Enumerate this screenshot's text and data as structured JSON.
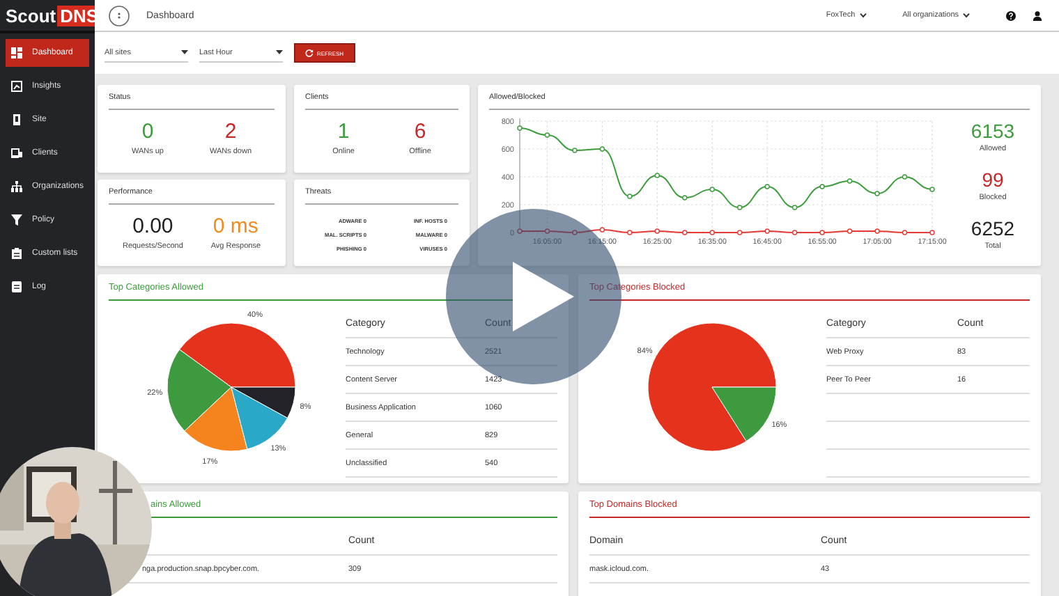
{
  "sidebar": {
    "logo": {
      "text": "Scout",
      "badge": "DNS"
    },
    "items": [
      {
        "label": "Dashboard",
        "selected": true
      },
      {
        "label": "Insights",
        "selected": false
      },
      {
        "label": "Site",
        "selected": false
      },
      {
        "label": "Clients",
        "selected": false
      },
      {
        "label": "Organizations",
        "selected": false
      },
      {
        "label": "Policy",
        "selected": false
      },
      {
        "label": "Custom lists",
        "selected": false
      },
      {
        "label": "Log",
        "selected": false
      }
    ]
  },
  "topbar": {
    "title": "Dashboard",
    "org": "FoxTech",
    "scope": "All organizations"
  },
  "filters": {
    "site": "All sites",
    "range": "Last Hour",
    "refresh": "REFRESH"
  },
  "status": {
    "title": "Status",
    "stats": [
      {
        "value": "0",
        "label": "WANs up",
        "color": "#3a9d3a"
      },
      {
        "value": "2",
        "label": "WANs down",
        "color": "#c62828"
      }
    ]
  },
  "performance": {
    "title": "Performance",
    "stats": [
      {
        "value": "0.00",
        "label": "Requests/Second",
        "color": "#222222"
      },
      {
        "value": "0 ms",
        "label": "Avg Response",
        "color": "#f08c1e"
      }
    ]
  },
  "clients": {
    "title": "Clients",
    "stats": [
      {
        "value": "1",
        "label": "Online",
        "color": "#3a9d3a"
      },
      {
        "value": "6",
        "label": "Offline",
        "color": "#c62828"
      }
    ]
  },
  "threats": {
    "title": "Threats",
    "items": [
      {
        "label": "ADWARE",
        "count": "0"
      },
      {
        "label": "INF. HOSTS",
        "count": "0"
      },
      {
        "label": "MAL. SCRIPTS",
        "count": "0"
      },
      {
        "label": "MALWARE",
        "count": "0"
      },
      {
        "label": "PHISHING",
        "count": "0"
      },
      {
        "label": "VIRUSES",
        "count": "0"
      }
    ]
  },
  "traffic": {
    "title": "Allowed/Blocked",
    "chart_data": {
      "type": "line",
      "grid": true,
      "categories": [
        null,
        "16:05:00",
        null,
        "16:15:00",
        null,
        "16:25:00",
        null,
        "16:35:00",
        null,
        "16:45:00",
        null,
        "16:55:00",
        null,
        "17:05:00",
        null,
        "17:15:00"
      ],
      "series": [
        {
          "color": "#3a9d3a",
          "marker": "o",
          "values": [
            750,
            700,
            590,
            600,
            260,
            410,
            250,
            310,
            180,
            330,
            180,
            330,
            370,
            280,
            400,
            310
          ]
        },
        {
          "color": "#e53935",
          "marker": "o",
          "values": [
            10,
            10,
            0,
            20,
            0,
            10,
            0,
            0,
            0,
            10,
            0,
            0,
            10,
            10,
            0,
            0
          ]
        }
      ],
      "ylim": [
        0,
        800
      ],
      "yticks": [
        0,
        200,
        400,
        600,
        800
      ]
    },
    "totals": [
      {
        "value": "6153",
        "label": "Allowed",
        "color": "#3a9d3a"
      },
      {
        "value": "99",
        "label": "Blocked",
        "color": "#c62828"
      },
      {
        "value": "6252",
        "label": "Total",
        "color": "#222222"
      }
    ]
  },
  "categories_allowed": {
    "title": "Top Categories Allowed",
    "kind": "allowed",
    "chart_data": {
      "type": "pie",
      "values": [
        40,
        22,
        17,
        13,
        8
      ],
      "colors": [
        "#e5321c",
        "#3e9a3e",
        "#f5841f",
        "#2aa8c8",
        "#222228"
      ],
      "value_labels": [
        "40%",
        "22%",
        "17%",
        "13%",
        "8%"
      ]
    },
    "columns": [
      "Category",
      "Count"
    ],
    "rows": [
      [
        "Technology",
        "2521"
      ],
      [
        "Content Server",
        "1423"
      ],
      [
        "Business Application",
        "1060"
      ],
      [
        "General",
        "829"
      ],
      [
        "Unclassified",
        "540"
      ]
    ]
  },
  "categories_blocked": {
    "title": "Top Categories Blocked",
    "kind": "blocked",
    "chart_data": {
      "type": "pie",
      "values": [
        84,
        16
      ],
      "colors": [
        "#e5321c",
        "#3e9a3e"
      ],
      "value_labels": [
        "84%",
        "16%"
      ]
    },
    "columns": [
      "Category",
      "Count"
    ],
    "rows": [
      [
        "Web Proxy",
        "83"
      ],
      [
        "Peer To Peer",
        "16"
      ]
    ]
  },
  "domains_allowed": {
    "title": "ains Allowed",
    "kind": "allowed",
    "count_heading": "Count",
    "rows": [
      {
        "domain": "nga.production.snap.bpcyber.com.",
        "count": "309"
      }
    ]
  },
  "domains_blocked": {
    "title": "Top Domains Blocked",
    "kind": "blocked",
    "domain_heading": "Domain",
    "count_heading": "Count",
    "rows": [
      {
        "domain": "mask.icloud.com.",
        "count": "43"
      }
    ]
  }
}
